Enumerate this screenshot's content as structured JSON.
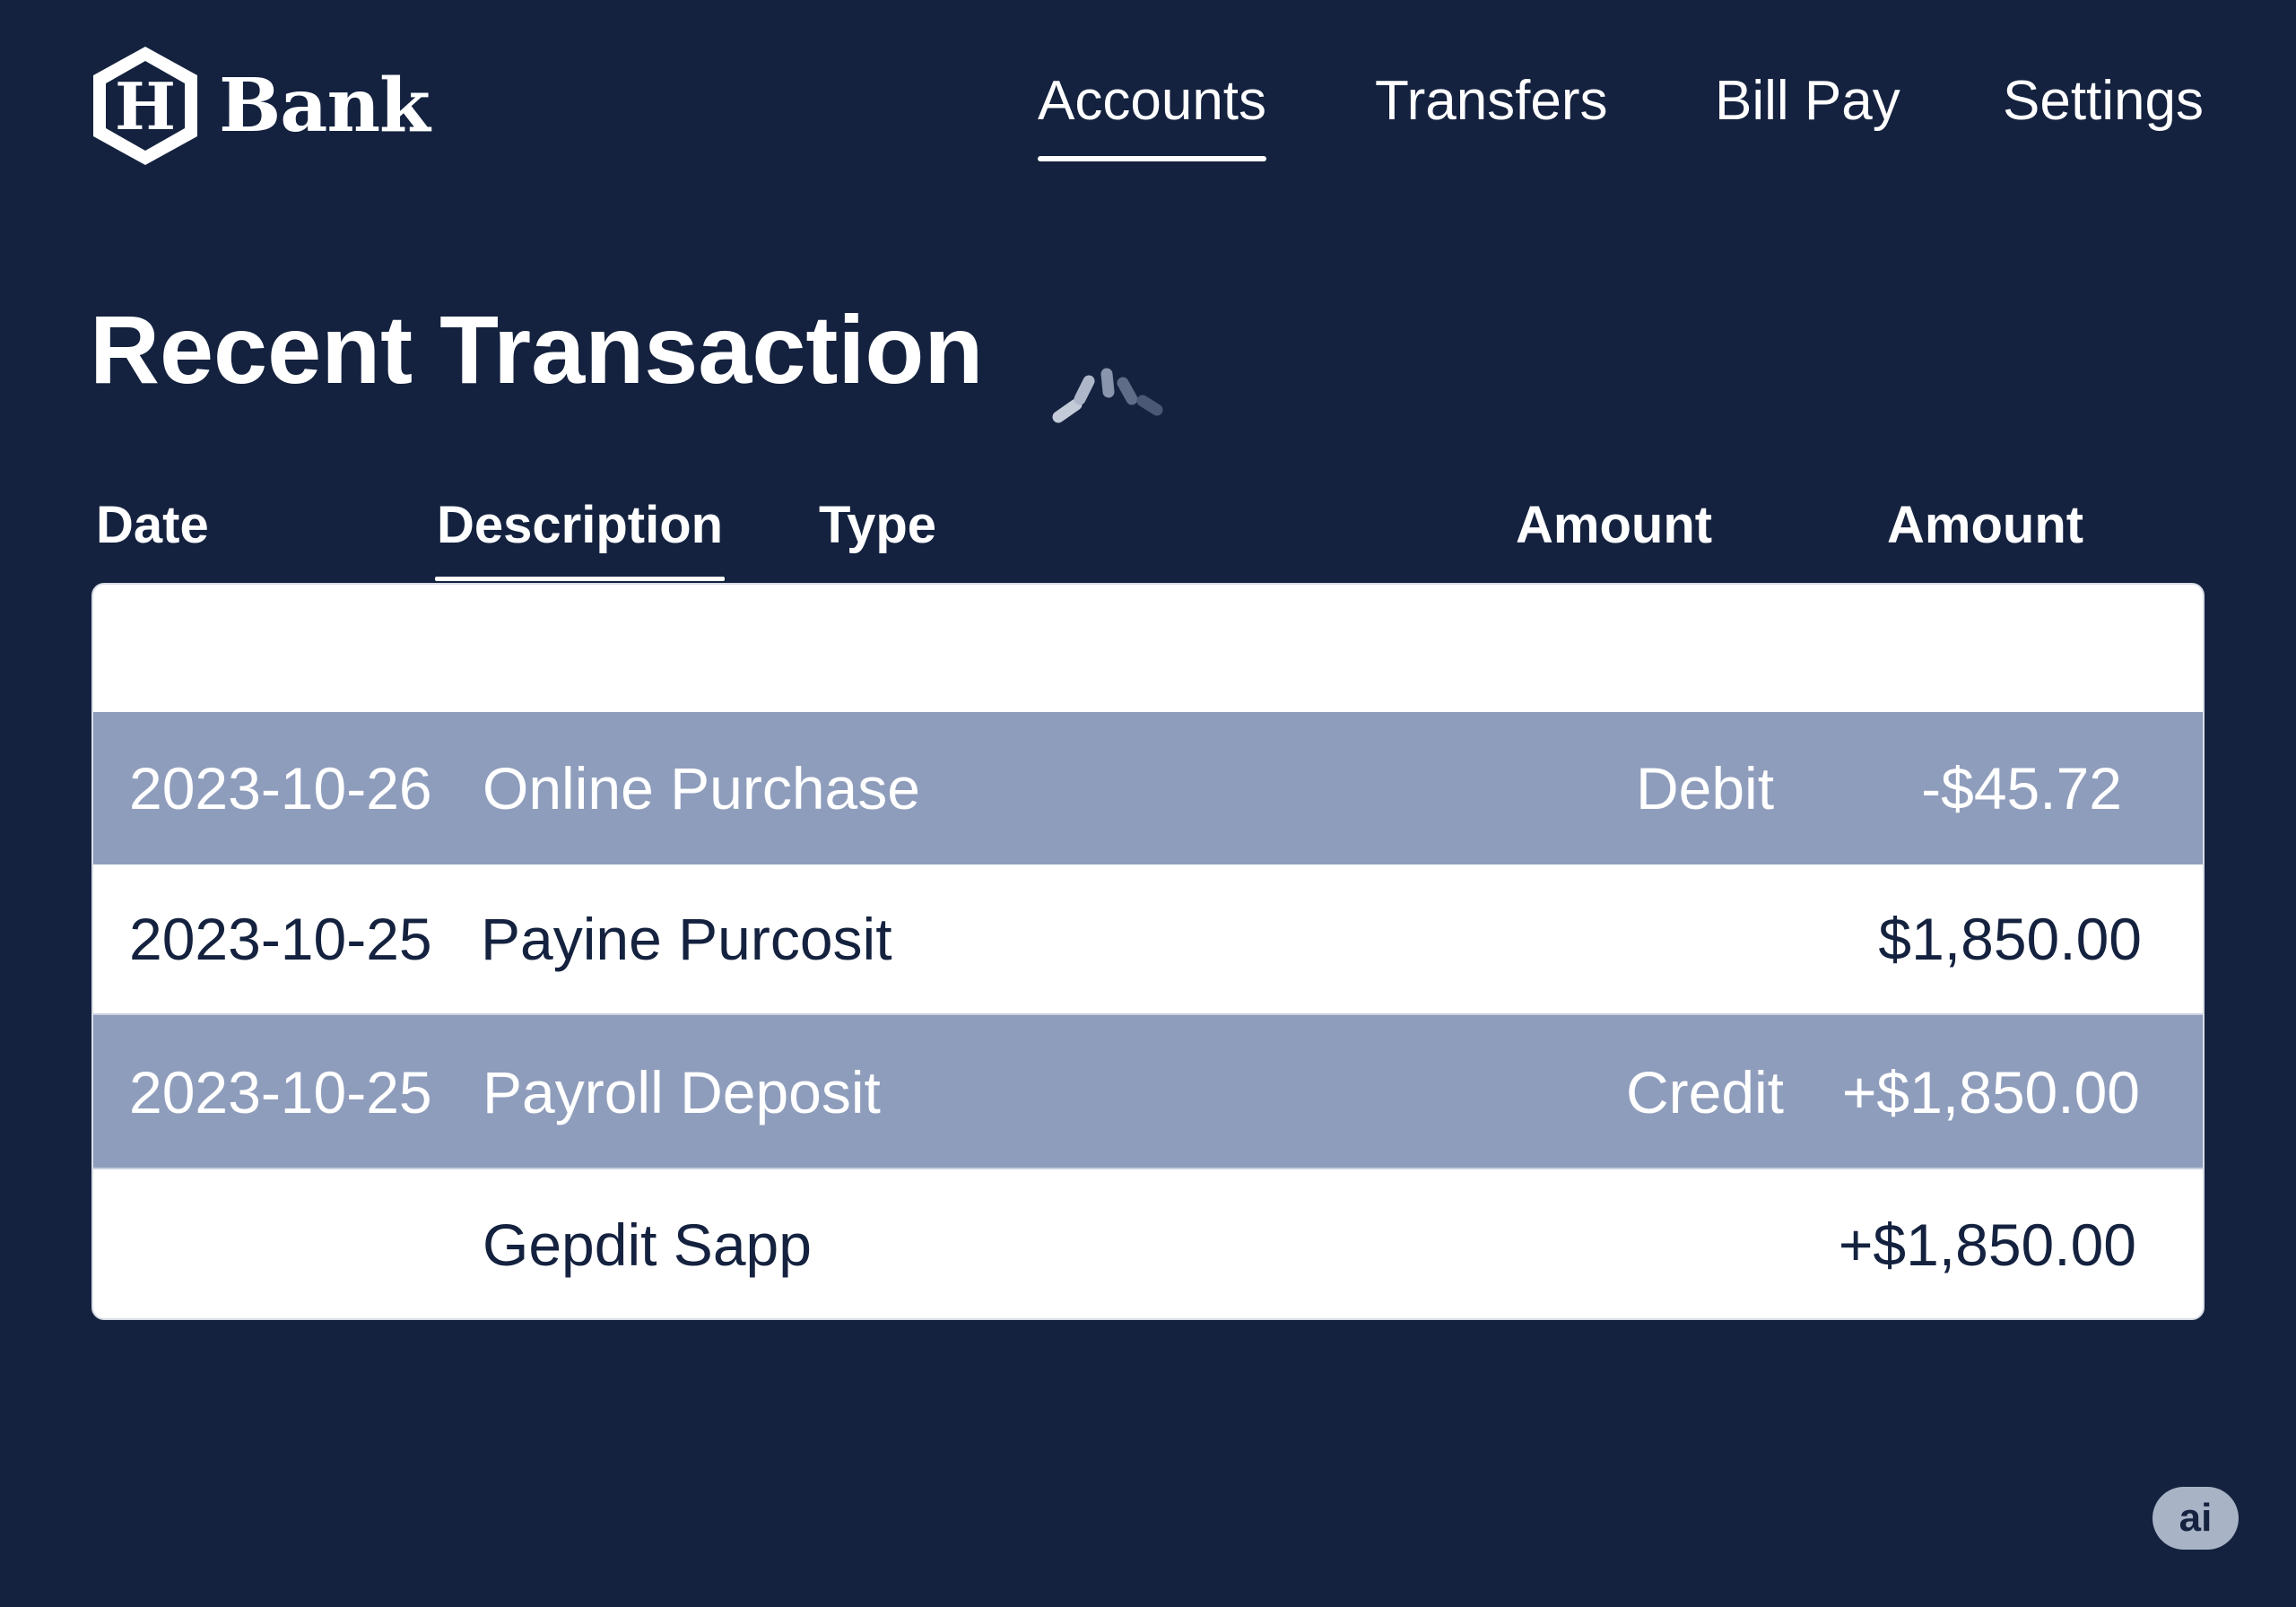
{
  "brand": {
    "logo_letter": "H",
    "name": "Bank"
  },
  "nav": {
    "items": [
      {
        "label": "Accounts",
        "active": true
      },
      {
        "label": "Transfers",
        "active": false
      },
      {
        "label": "Bill Pay",
        "active": false
      },
      {
        "label": "Settings",
        "active": false
      }
    ]
  },
  "main": {
    "title": "Recent Transaction",
    "loading": true
  },
  "table": {
    "headers": [
      "Date",
      "Description",
      "Type",
      "Amount",
      "Amount"
    ],
    "sorted_column": "Description",
    "rows": [
      {
        "date": "",
        "description": "",
        "type": "",
        "amount": ""
      },
      {
        "date": "2023-10-26",
        "description": "Online Purchase",
        "type": "Debit",
        "amount": "-$45.72"
      },
      {
        "date": "2023-10-25",
        "description": "Payine Purcosit",
        "type": "",
        "amount": "$1,850.00"
      },
      {
        "date": "2023-10-25",
        "description": "Payroll Deposit",
        "type": "Credit",
        "amount": "+$1,850.00"
      },
      {
        "date": "",
        "description": "Gepdit Sapp",
        "type": "",
        "amount": "+$1,850.00"
      }
    ]
  },
  "badge": {
    "label": "ai"
  },
  "colors": {
    "background": "#14223f",
    "highlight_row": "#8f9dbc",
    "table_bg": "#ffffff",
    "text_dark": "#14223f",
    "text_light": "#ffffff"
  },
  "icons": {
    "logo": "hexagon-h-icon",
    "loading": "spinner-icon"
  }
}
